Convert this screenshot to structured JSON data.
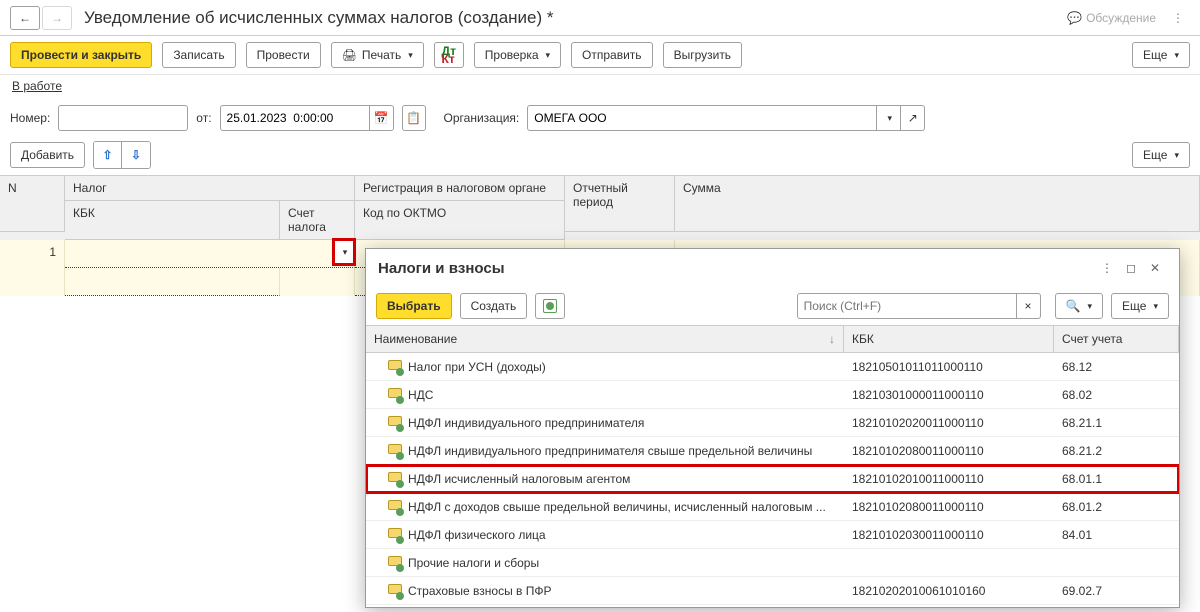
{
  "header": {
    "title": "Уведомление об исчисленных суммах налогов (создание) *",
    "discuss": "Обсуждение"
  },
  "toolbar": {
    "post_close": "Провести и закрыть",
    "write": "Записать",
    "post": "Провести",
    "print": "Печать",
    "check": "Проверка",
    "send": "Отправить",
    "upload": "Выгрузить",
    "more": "Еще"
  },
  "status": {
    "label": "В работе"
  },
  "form": {
    "number_label": "Номер:",
    "number_value": "",
    "from_label": "от:",
    "date_value": "25.01.2023  0:00:00",
    "org_label": "Организация:",
    "org_value": "ОМЕГА ООО"
  },
  "subtoolbar": {
    "add": "Добавить",
    "more": "Еще"
  },
  "grid": {
    "cols": {
      "n": "N",
      "tax": "Налог",
      "kbk": "КБК",
      "acc": "Счет налога",
      "reg": "Регистрация в налоговом органе",
      "oktmo": "Код по ОКТМО",
      "period": "Отчетный период",
      "sum": "Сумма"
    },
    "row_n": "1"
  },
  "popup": {
    "title": "Налоги и взносы",
    "select": "Выбрать",
    "create": "Создать",
    "search_placeholder": "Поиск (Ctrl+F)",
    "more": "Еще",
    "cols": {
      "name": "Наименование",
      "kbk": "КБК",
      "acc": "Счет учета"
    },
    "rows": [
      {
        "name": "Налог при УСН (доходы)",
        "kbk": "18210501011011000110",
        "acc": "68.12"
      },
      {
        "name": "НДС",
        "kbk": "18210301000011000110",
        "acc": "68.02"
      },
      {
        "name": "НДФЛ индивидуального предпринимателя",
        "kbk": "18210102020011000110",
        "acc": "68.21.1"
      },
      {
        "name": "НДФЛ индивидуального предпринимателя свыше предельной величины",
        "kbk": "18210102080011000110",
        "acc": "68.21.2"
      },
      {
        "name": "НДФЛ исчисленный налоговым агентом",
        "kbk": "18210102010011000110",
        "acc": "68.01.1",
        "hl": true
      },
      {
        "name": "НДФЛ с доходов свыше предельной величины, исчисленный налоговым ...",
        "kbk": "18210102080011000110",
        "acc": "68.01.2"
      },
      {
        "name": "НДФЛ физического лица",
        "kbk": "18210102030011000110",
        "acc": "84.01"
      },
      {
        "name": "Прочие налоги и сборы",
        "kbk": "",
        "acc": ""
      },
      {
        "name": "Страховые взносы в ПФР",
        "kbk": "18210202010061010160",
        "acc": "69.02.7"
      }
    ]
  }
}
